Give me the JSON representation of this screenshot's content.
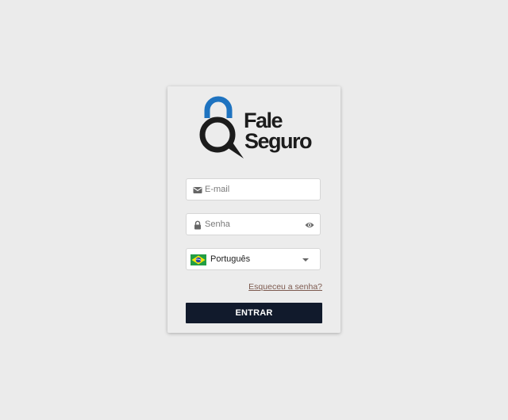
{
  "logo": {
    "line1": "Fale",
    "line2": "Seguro",
    "accent_color": "#1e73c0",
    "dark_color": "#1c1c1c"
  },
  "form": {
    "email": {
      "placeholder": "E-mail",
      "icon": "envelope-icon"
    },
    "password": {
      "placeholder": "Senha",
      "icon": "lock-icon",
      "toggle_icon": "eye-icon"
    },
    "language": {
      "selected": "Português",
      "flag": "brazil-flag-icon"
    },
    "forgot_link": "Esqueceu a senha?",
    "submit_label": "ENTRAR"
  },
  "colors": {
    "background": "#ebebeb",
    "card": "#ececec",
    "button": "#111a2c",
    "link": "#7d5a4f"
  }
}
